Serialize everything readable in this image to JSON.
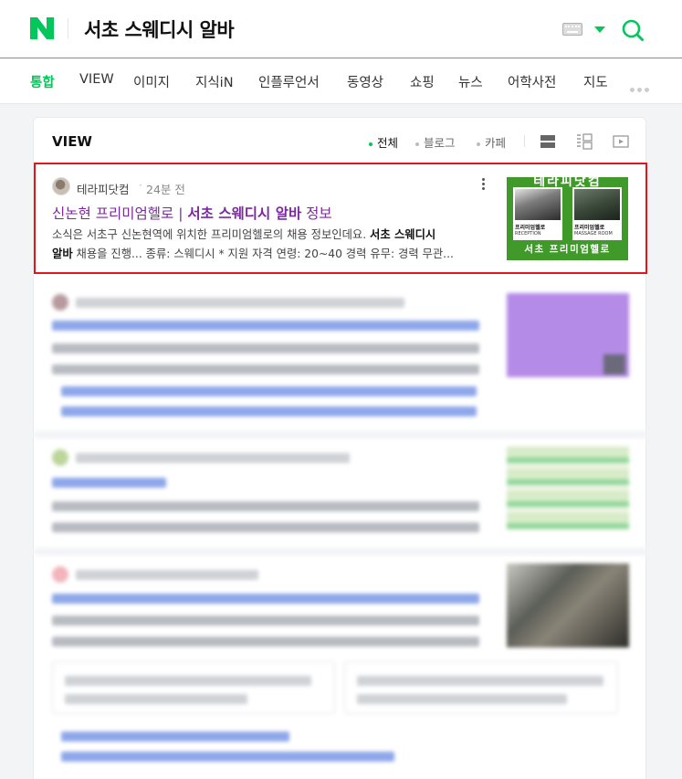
{
  "header": {
    "logo_letter": "N",
    "query": "서초 스웨디시 알바",
    "brand_color": "#03c75a"
  },
  "tabs": [
    {
      "label": "통합",
      "active": true
    },
    {
      "label": "VIEW"
    },
    {
      "label": "이미지"
    },
    {
      "label": "지식iN"
    },
    {
      "label": "인플루언서"
    },
    {
      "label": "동영상"
    },
    {
      "label": "쇼핑"
    },
    {
      "label": "뉴스"
    },
    {
      "label": "어학사전"
    },
    {
      "label": "지도"
    }
  ],
  "view": {
    "title": "VIEW",
    "filters": [
      {
        "label": "전체",
        "active": true
      },
      {
        "label": "블로그"
      },
      {
        "label": "카페"
      }
    ]
  },
  "post": {
    "author": "테라피닷컴",
    "time": "24분 전",
    "title_prefix": "신논현 프리미엄헬로 | ",
    "title_bold": "서초 스웨디시 알바",
    "title_suffix": " 정보",
    "snippet_1": "소식은 서초구 신논현역에 위치한 프리미엄헬로의 채용 정보인데요. ",
    "snippet_bold_1": "서초 스웨디시",
    "snippet_bold_2": "알바",
    "snippet_2": " 채용을 진행... 종류: 스웨디시 * 지원 자격 연령: 20~40 경력 유무: 경력 무관...",
    "thumbnail": {
      "head": "테라피닷컴",
      "photo1_label": "프리미엄헬로",
      "photo1_sub": "RECEPTION",
      "photo2_label": "프리미엄헬로",
      "photo2_sub": "MASSAGE ROOM",
      "foot": "서초 프리미엄헬로"
    },
    "highlight_color": "#e0161b"
  }
}
